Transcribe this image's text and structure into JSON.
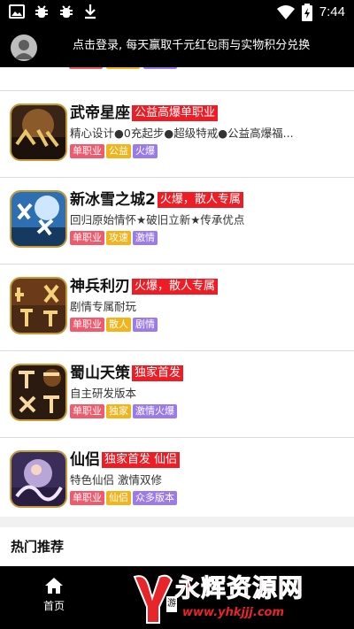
{
  "status_bar": {
    "time": "7:44",
    "icons": [
      "image-icon",
      "bug-icon",
      "bug-icon",
      "download-icon",
      "wifi-icon",
      "battery-icon"
    ]
  },
  "login_bar": {
    "text": "点击登录, 每天赢取千元红包雨与实物积分兑换"
  },
  "games": [
    {
      "name": "武帝星座",
      "badge": "公益高爆单职业",
      "description": "精心设计●0充起步●超级特戒●公益高爆福...",
      "tags": [
        {
          "label": "单职业",
          "color": "red"
        },
        {
          "label": "公益",
          "color": "yellow"
        },
        {
          "label": "火爆",
          "color": "purple"
        }
      ]
    },
    {
      "name": "新冰雪之城2",
      "badge": "火爆，散人专属",
      "description": "回归原始情怀★破旧立新★传承优点",
      "tags": [
        {
          "label": "单职业",
          "color": "red"
        },
        {
          "label": "攻速",
          "color": "yellow"
        },
        {
          "label": "激情",
          "color": "purple"
        }
      ]
    },
    {
      "name": "神兵利刃",
      "badge": "火爆，散人专属",
      "description": "剧情专属耐玩",
      "tags": [
        {
          "label": "单职业",
          "color": "red"
        },
        {
          "label": "散人",
          "color": "yellow"
        },
        {
          "label": "剧情",
          "color": "purple"
        }
      ]
    },
    {
      "name": "蜀山天策",
      "badge": "独家首发",
      "description": "自主研发版本",
      "tags": [
        {
          "label": "单职业",
          "color": "red"
        },
        {
          "label": "独家",
          "color": "yellow"
        },
        {
          "label": "激情火爆",
          "color": "purple"
        }
      ]
    },
    {
      "name": "仙侣",
      "badge": "独家首发 仙侣",
      "description": "特色仙侣 激情双修",
      "tags": [
        {
          "label": "单职业",
          "color": "red"
        },
        {
          "label": "仙侣",
          "color": "yellow"
        },
        {
          "label": "众多版本",
          "color": "purple"
        }
      ]
    }
  ],
  "hot_section": {
    "title": "热门推荐"
  },
  "bottom_nav": {
    "home_label": "首页",
    "middle_label": "游"
  },
  "watermark": {
    "title": "永辉资源网",
    "url": "www.yhkjjj.com"
  },
  "colors": {
    "badge": "#ee1c24",
    "tag_red": "#ef5b6d",
    "tag_yellow": "#f1b41c",
    "tag_purple": "#9b7be8",
    "bar": "#000000"
  }
}
